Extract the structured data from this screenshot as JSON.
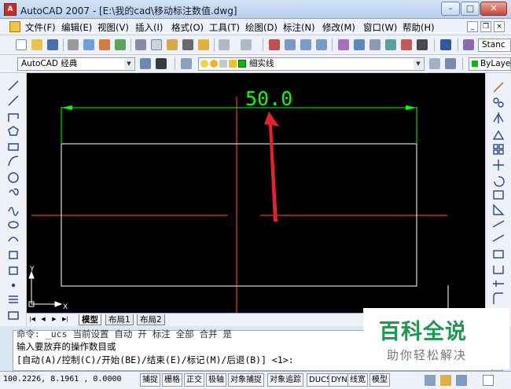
{
  "window": {
    "title": "AutoCAD 2007 - [E:\\我的cad\\移动标注数值.dwg]",
    "app_icon": "A",
    "minimize": "–",
    "maximize": "□",
    "close": "✕"
  },
  "menu": {
    "items": [
      "文件(F)",
      "编辑(E)",
      "视图(V)",
      "插入(I)",
      "格式(O)",
      "工具(T)",
      "绘图(D)",
      "标注(N)",
      "修改(M)",
      "窗口(W)",
      "帮助(H)"
    ],
    "mdi_minimize": "_",
    "mdi_restore": "❐",
    "mdi_close": "×"
  },
  "toolbar2": {
    "text_style": "Stanc"
  },
  "toolbar3": {
    "workspace": "AutoCAD 经典",
    "layer": "细实线",
    "color": "ByLayer"
  },
  "drawing": {
    "dimension_text": "50.0",
    "ucs_x": "X",
    "ucs_y": "Y",
    "accent": "#00ff00",
    "arrow_color": "#e8202c"
  },
  "tabs": {
    "model": "模型",
    "layout1": "布局1",
    "layout2": "布局2"
  },
  "command": {
    "line1": "命令: _ucs  当前设置   自动   开   标注   全部   合并   是",
    "line2": "输入要放弃的操作数目或",
    "line3": "[自动(A)/控制(C)/开始(BE)/结束(E)/标记(M)/后退(B)] <1>:"
  },
  "status": {
    "coords": "100.2226, 8.1961 , 0.0000",
    "buttons": [
      "捕捉",
      "栅格",
      "正交",
      "极轴",
      "对象捕捉",
      "对象追踪",
      "DUCS",
      "DYN",
      "线宽",
      "模型"
    ]
  },
  "watermark": {
    "title": "百科全说",
    "subtitle": "助你轻松解决"
  }
}
